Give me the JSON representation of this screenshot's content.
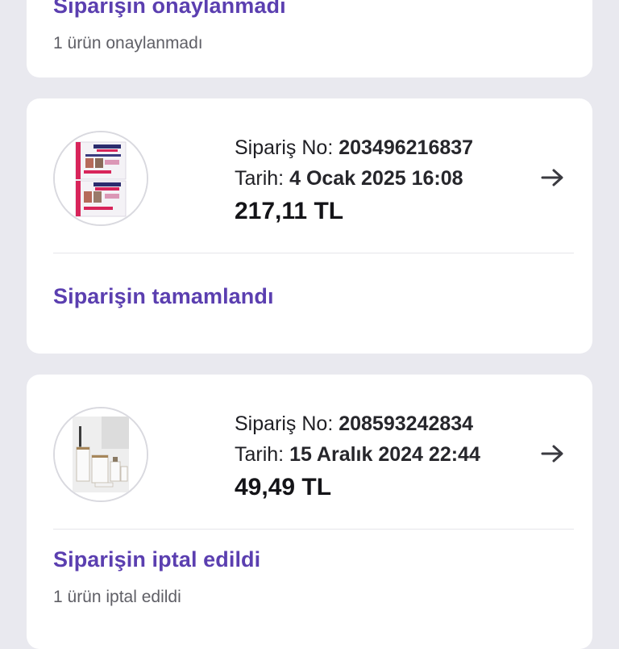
{
  "cards": [
    {
      "status": "Siparişin onaylanmadı",
      "detail": "1 ürün onaylanmadı"
    },
    {
      "order_label": "Sipariş No:",
      "order_no": "203496216837",
      "date_label": "Tarih:",
      "date": "4 Ocak 2025 16:08",
      "total": "217,11 TL",
      "status": "Siparişin tamamlandı",
      "thumbnail_icon": "book-covers-thumbnail",
      "arrow_icon": "arrow-right-icon"
    },
    {
      "order_label": "Sipariş No:",
      "order_no": "208593242834",
      "date_label": "Tarih:",
      "date": "15 Aralık 2024 22:44",
      "total": "49,49 TL",
      "status": "Siparişin iptal edildi",
      "detail": "1 ürün iptal edildi",
      "thumbnail_icon": "bathroom-set-thumbnail",
      "arrow_icon": "arrow-right-icon"
    }
  ],
  "colors": {
    "background": "#e9e9ef",
    "card": "#ffffff",
    "status_purple": "#5b3fb0",
    "text_dark": "#1f1f24",
    "text_muted": "#5f5f66"
  }
}
